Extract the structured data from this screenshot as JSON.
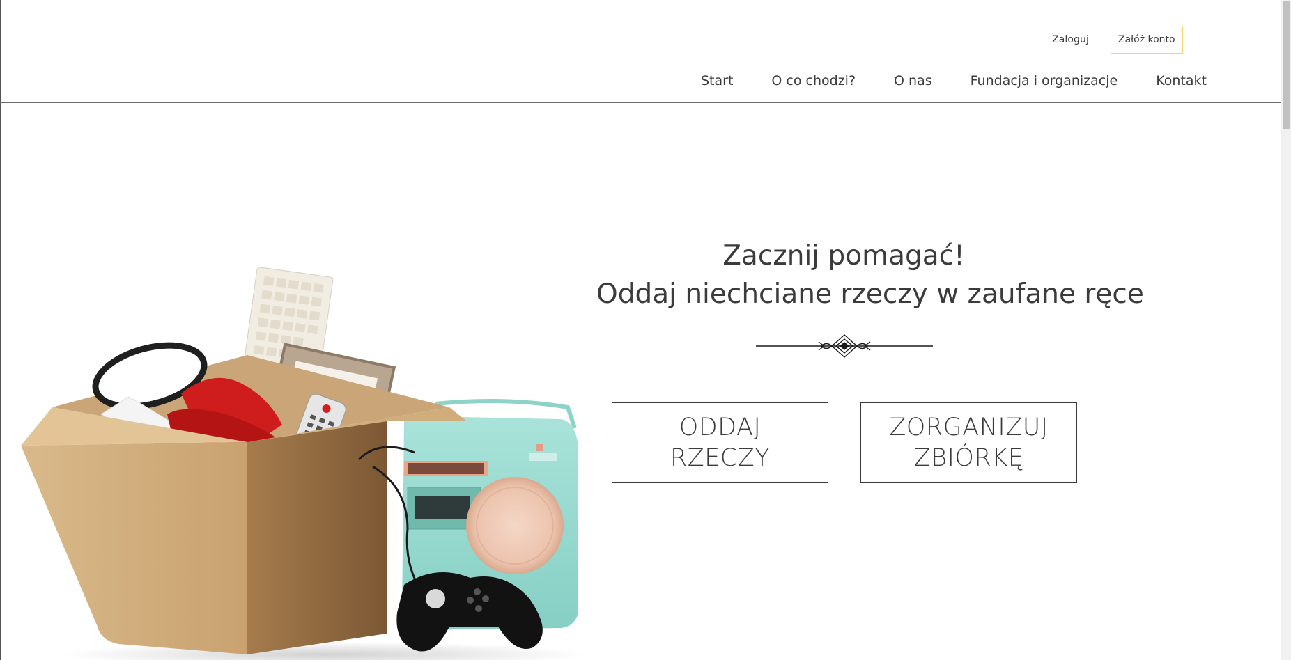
{
  "header": {
    "login_label": "Zaloguj",
    "register_label": "Załóż konto",
    "register_border_color": "#f3d96f",
    "nav": [
      {
        "label": "Start"
      },
      {
        "label": "O co chodzi?"
      },
      {
        "label": "O nas"
      },
      {
        "label": "Fundacja i organizacje"
      },
      {
        "label": "Kontakt"
      }
    ]
  },
  "hero": {
    "title_line1": "Zacznij pomagać!",
    "title_line2": "Oddaj niechciane rzeczy w zaufane ręce",
    "cta_give": {
      "line1": "ODDAJ",
      "line2": "RZECZY"
    },
    "cta_organize": {
      "line1": "ZORGANIZUJ",
      "line2": "ZBIÓRKĘ"
    }
  }
}
